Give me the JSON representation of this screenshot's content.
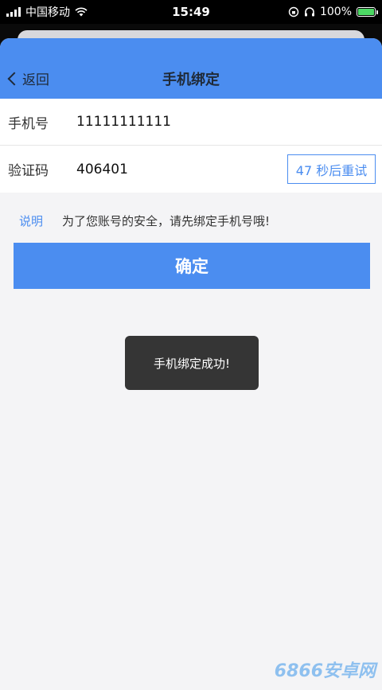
{
  "status_bar": {
    "carrier": "中国移动",
    "time": "15:49",
    "battery": "100%"
  },
  "nav": {
    "back_label": "返回",
    "title": "手机绑定"
  },
  "form": {
    "phone_label": "手机号",
    "phone_value": "11111111111",
    "code_label": "验证码",
    "code_value": "406401",
    "retry_label": "47 秒后重试"
  },
  "note": {
    "tag": "说明",
    "text": "为了您账号的安全，请先绑定手机号哦!"
  },
  "confirm_label": "确定",
  "toast": "手机绑定成功!",
  "watermark": "6866安卓网",
  "colors": {
    "accent": "#4b8df0",
    "toast_bg": "#353535",
    "page_bg": "#f4f4f6"
  },
  "icons": [
    "signal-icon",
    "wifi-icon",
    "lock-rotation-icon",
    "headphones-icon",
    "battery-icon",
    "chevron-left-icon"
  ]
}
